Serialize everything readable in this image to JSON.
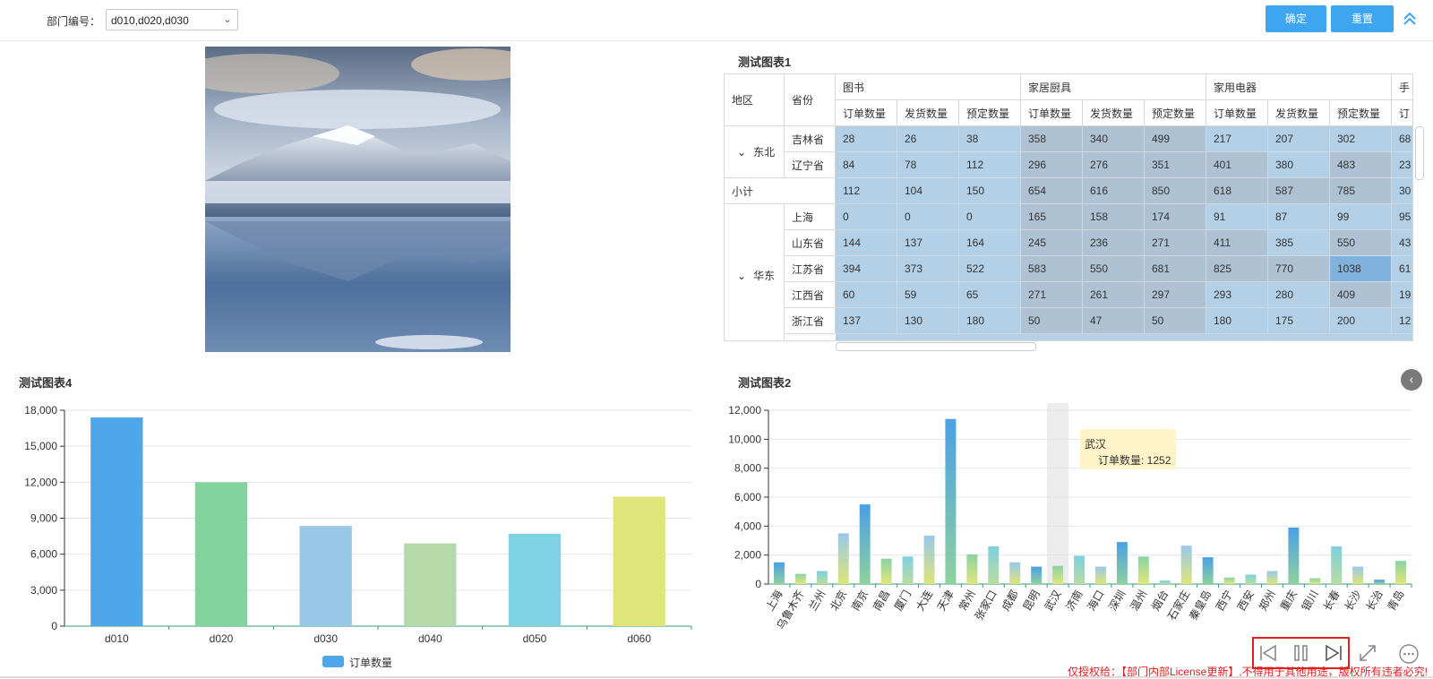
{
  "filter": {
    "label": "部门编号：",
    "value": "d010,d020,d030"
  },
  "buttons": {
    "confirm": "确定",
    "reset": "重置"
  },
  "panels": {
    "table_title": "测试图表1",
    "bar_title": "测试图表4",
    "column_title": "测试图表2"
  },
  "table": {
    "head_region": "地区",
    "head_province": "省份",
    "groups": [
      "图书",
      "家居厨具",
      "家用电器",
      "手"
    ],
    "metrics": [
      "订单数量",
      "发货数量",
      "预定数量",
      "订单数量",
      "发货数量",
      "预定数量",
      "订单数量",
      "发货数量",
      "预定数量",
      "订"
    ],
    "regions": {
      "dongbei": "东北",
      "huadong": "华东"
    },
    "subtotal_label": "小计",
    "rows": [
      {
        "province": "吉林省",
        "values": [
          "28",
          "26",
          "38",
          "358",
          "340",
          "499",
          "217",
          "207",
          "302",
          "68"
        ]
      },
      {
        "province": "辽宁省",
        "values": [
          "84",
          "78",
          "112",
          "296",
          "276",
          "351",
          "401",
          "380",
          "483",
          "23"
        ]
      },
      {
        "province": "",
        "values": [
          "112",
          "104",
          "150",
          "654",
          "616",
          "850",
          "618",
          "587",
          "785",
          "30"
        ]
      },
      {
        "province": "上海",
        "values": [
          "0",
          "0",
          "0",
          "165",
          "158",
          "174",
          "91",
          "87",
          "99",
          "95"
        ]
      },
      {
        "province": "山东省",
        "values": [
          "144",
          "137",
          "164",
          "245",
          "236",
          "271",
          "411",
          "385",
          "550",
          "43"
        ]
      },
      {
        "province": "江苏省",
        "values": [
          "394",
          "373",
          "522",
          "583",
          "550",
          "681",
          "825",
          "770",
          "1038",
          "61"
        ]
      },
      {
        "province": "江西省",
        "values": [
          "60",
          "59",
          "65",
          "271",
          "261",
          "297",
          "293",
          "280",
          "409",
          "19"
        ]
      },
      {
        "province": "浙江省",
        "values": [
          "137",
          "130",
          "180",
          "50",
          "47",
          "50",
          "180",
          "175",
          "200",
          "12"
        ]
      }
    ]
  },
  "tooltip": {
    "city": "武汉",
    "text": "订单数量: 1252"
  },
  "license": "仅授权给：【部门内部License更新】,不得用于其他用途，版权所有违者必究!",
  "icons": [
    "chevron-up-icon",
    "chevron-down-icon",
    "left-arrow-icon",
    "skip-back-icon",
    "pause-icon",
    "skip-forward-icon",
    "fullscreen-icon",
    "more-icon"
  ],
  "colors": {
    "button": "#3ea5f0",
    "cell_light": "#b3d0e6",
    "cell_mid": "#aec2d3",
    "cell_highlight": "#7fb2dc",
    "license": "#e02020"
  },
  "chart_data": [
    {
      "type": "bar",
      "title": "测试图表4",
      "categories": [
        "d010",
        "d020",
        "d030",
        "d040",
        "d050",
        "d060"
      ],
      "series": [
        {
          "name": "订单数量",
          "values": [
            17400,
            12000,
            8350,
            6900,
            7700,
            10800
          ]
        }
      ],
      "yticks": [
        "0",
        "3,000",
        "6,000",
        "9,000",
        "12,000",
        "15,000",
        "18,000"
      ],
      "ylim": [
        0,
        18000
      ],
      "colors": [
        "#4fa7ea",
        "#84d39f",
        "#99c7e7",
        "#b5d9a8",
        "#7ed3e2",
        "#dfe579"
      ],
      "legend": "bottom-center",
      "grid": true
    },
    {
      "type": "bar",
      "title": "测试图表2",
      "categories": [
        "上海",
        "乌鲁木齐",
        "兰州",
        "北京",
        "南京",
        "南昌",
        "厦门",
        "大连",
        "天津",
        "常州",
        "张家口",
        "成都",
        "昆明",
        "武汉",
        "济南",
        "海口",
        "深圳",
        "温州",
        "烟台",
        "石家庄",
        "秦皇岛",
        "西宁",
        "西安",
        "郑州",
        "重庆",
        "银川",
        "长春",
        "长沙",
        "长治",
        "青岛"
      ],
      "series": [
        {
          "name": "订单数量",
          "values": [
            1500,
            700,
            900,
            3500,
            5500,
            1750,
            1900,
            3350,
            11400,
            2050,
            2600,
            1500,
            1200,
            1252,
            1950,
            1200,
            2900,
            1900,
            250,
            2650,
            1850,
            450,
            650,
            900,
            3900,
            400,
            2600,
            1200,
            300,
            1600
          ]
        }
      ],
      "yticks": [
        "0",
        "2,000",
        "4,000",
        "6,000",
        "8,000",
        "10,000",
        "12,000"
      ],
      "ylim": [
        0,
        12000
      ],
      "highlight": "武汉",
      "grid": true
    }
  ]
}
